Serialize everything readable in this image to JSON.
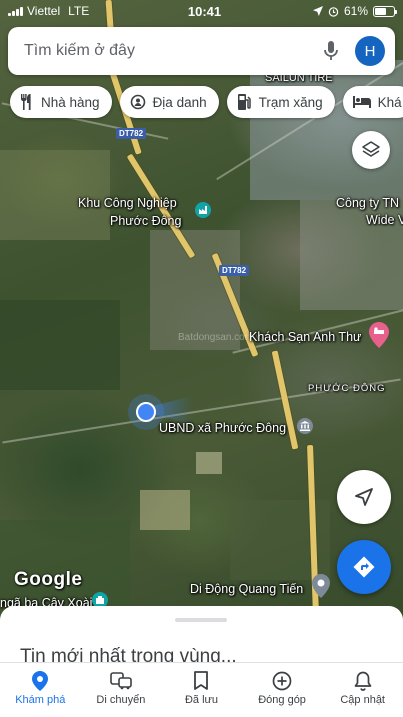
{
  "status_bar": {
    "carrier": "Viettel",
    "network": "LTE",
    "time": "10:41",
    "battery_percent": "61%",
    "battery_level": 0.61
  },
  "search": {
    "placeholder": "Tìm kiếm ở đây",
    "avatar_initial": "H"
  },
  "chips": [
    {
      "label": "Nhà hàng",
      "icon": "restaurant-icon"
    },
    {
      "label": "Địa danh",
      "icon": "landmark-icon"
    },
    {
      "label": "Trạm xăng",
      "icon": "gas-station-icon"
    },
    {
      "label": "Khá",
      "icon": "hotel-icon"
    }
  ],
  "map": {
    "labels": {
      "sailun": "SAILUN TIRE",
      "kcn_line1": "Khu Công Nghiệp",
      "kcn_line2": "Phước Đông",
      "cong_ty_line1": "Công ty TN",
      "cong_ty_line2": "Wide V",
      "khach_san": "Khách Sạn Anh Thư",
      "phuoc_dong_area": "PHƯỚC ĐÔNG",
      "ubnd": "UBND xã Phước Đông",
      "di_dong": "Di Động Quang Tiến",
      "nga_ba": "ngã ba Cây Xoài",
      "watermark": "Batdongsan.com.vn"
    },
    "road_shields": [
      "DT782",
      "DT782"
    ],
    "attribution": "Google"
  },
  "bottom_sheet": {
    "title": "Tin mới nhất trong vùng..."
  },
  "nav": [
    {
      "label": "Khám phá",
      "icon": "explore-pin-icon",
      "active": true
    },
    {
      "label": "Di chuyển",
      "icon": "commute-icon",
      "active": false
    },
    {
      "label": "Đã lưu",
      "icon": "bookmark-icon",
      "active": false
    },
    {
      "label": "Đóng góp",
      "icon": "add-circle-icon",
      "active": false
    },
    {
      "label": "Cập nhật",
      "icon": "bell-icon",
      "active": false
    }
  ],
  "colors": {
    "accent": "#1a73e8",
    "avatar": "#1565c0",
    "road": "#e0c56a",
    "hotel_pin": "#e8618c",
    "poi_teal": "#12a4a4",
    "location_dot": "#4285f4"
  }
}
